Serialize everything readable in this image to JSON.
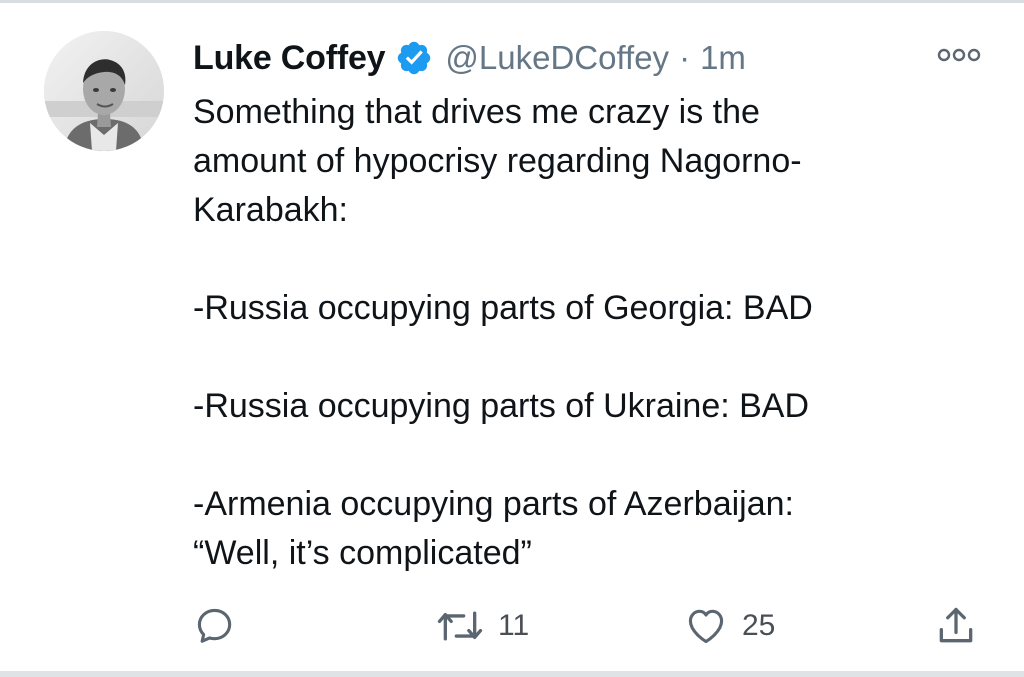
{
  "tweet": {
    "display_name": "Luke Coffey",
    "handle": "@LukeDCoffey",
    "separator": "·",
    "time": "1m",
    "text": "Something that drives me crazy is the\namount of hypocrisy regarding Nagorno-\nKarabakh:\n\n-Russia occupying parts of Georgia: BAD\n\n-Russia occupying parts of Ukraine: BAD\n\n-Armenia occupying parts of Azerbaijan:\n“Well, it’s complicated”",
    "verified": true,
    "avatar_icon": "profile-photo"
  },
  "actions": {
    "reply": {
      "icon": "reply-icon"
    },
    "retweet": {
      "icon": "retweet-icon",
      "count": "11"
    },
    "like": {
      "icon": "heart-icon",
      "count": "25"
    },
    "share": {
      "icon": "share-icon"
    },
    "more": {
      "icon": "more-options-icon"
    }
  },
  "colors": {
    "text": "#0f1419",
    "secondary": "#657786",
    "verified": "#1d9bf0",
    "icons": "#5b6670"
  }
}
